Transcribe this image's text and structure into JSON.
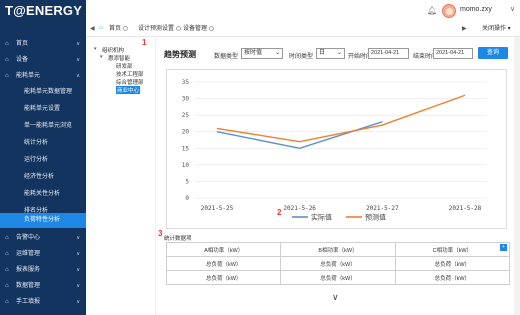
{
  "app": {
    "logo_text": "T@ENERGY"
  },
  "header": {
    "username": "momo.zxy",
    "user_caret": "∨",
    "bell_icon": "bell-icon"
  },
  "tabs": {
    "left_arrow": "◀",
    "home_icon": "home-icon",
    "items": [
      {
        "label": "首页"
      },
      {
        "label": "设计预测设置"
      },
      {
        "label": "设备管理"
      }
    ],
    "right_arrow": "▶",
    "close_ops": "关闭操作 ▾"
  },
  "sidebar": {
    "items": [
      {
        "label": "首页",
        "caret": "∨"
      },
      {
        "label": "设备",
        "caret": "∨"
      },
      {
        "label": "能耗单元",
        "caret": "∧"
      },
      {
        "label": "告警中心",
        "caret": "∨"
      },
      {
        "label": "运维管理",
        "caret": "∨"
      },
      {
        "label": "报表服务",
        "caret": "∨"
      },
      {
        "label": "数据管理",
        "caret": "∨"
      },
      {
        "label": "手工填报",
        "caret": "∨"
      }
    ],
    "subitems": [
      {
        "label": "能耗单元数据管理"
      },
      {
        "label": "能耗单元设置"
      },
      {
        "label": "单一能耗单元浏览"
      },
      {
        "label": "统计分析"
      },
      {
        "label": "运行分析"
      },
      {
        "label": "经济性分析"
      },
      {
        "label": "能耗关性分析"
      },
      {
        "label": "排名分析"
      },
      {
        "label": "负荷特性分析"
      }
    ]
  },
  "tree": {
    "root": "组织机构",
    "child": "惠添智能",
    "leaves": [
      "研发部",
      "技术工程部",
      "综合管理部",
      "商业中心"
    ],
    "marker": "1"
  },
  "panel": {
    "title": "趋势预测",
    "data_type_label": "数据类型",
    "data_type_value": "按时值",
    "period_label": "时间类型",
    "period_value": "日",
    "start_label": "开始时间",
    "start_value": "2021-04-21",
    "end_label": "结束时间",
    "end_value": "2021-04-21",
    "query_button": "查询",
    "marker_2": "2",
    "marker_3": "3"
  },
  "chart_data": {
    "type": "line",
    "categories": [
      "2021-5-25",
      "2021-5-26",
      "2021-5-27",
      "2021-5-28"
    ],
    "ylim": [
      0,
      35
    ],
    "yticks": [
      0,
      5,
      10,
      15,
      20,
      25,
      30,
      35
    ],
    "grid": true,
    "legend_position": "bottom",
    "series": [
      {
        "name": "实际值",
        "color": "#5b8fd4",
        "values": [
          20,
          15,
          23,
          null
        ]
      },
      {
        "name": "预测值",
        "color": "#f07f2e",
        "values": [
          21,
          17,
          22,
          31
        ]
      }
    ]
  },
  "stats": {
    "title": "统计数据项",
    "headers": [
      "A相功率（kW）",
      "B相功率（kW）",
      "C相功率（kW）"
    ],
    "rows": [
      [
        "总负荷（kW）",
        "总负荷（kW）",
        "总负荷（kW）"
      ],
      [
        "总负荷（kW）",
        "总负荷（kW）",
        "总负荷（kW）"
      ]
    ],
    "badge": "+",
    "expand_icon": "∨"
  }
}
